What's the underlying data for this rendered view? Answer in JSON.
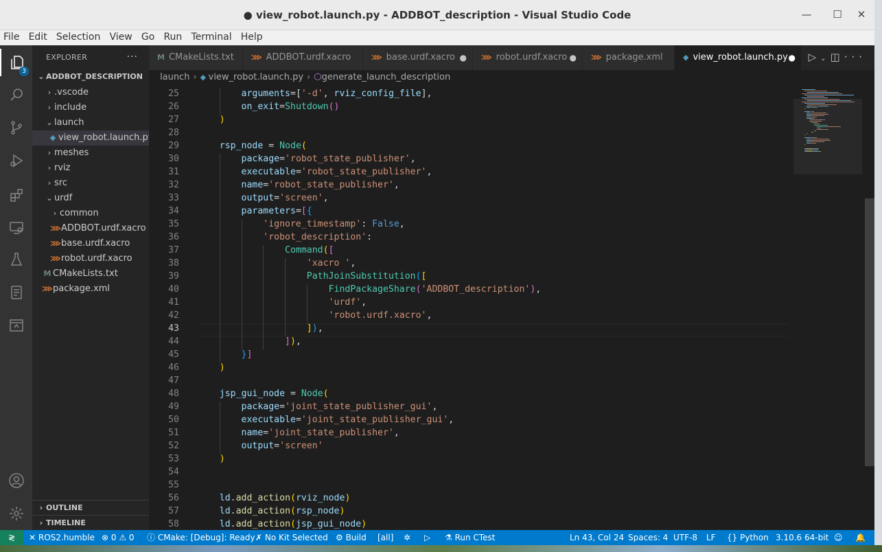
{
  "window": {
    "title": "● view_robot.launch.py - ADDBOT_description - Visual Studio Code",
    "controls": [
      "—",
      "☐",
      "✕"
    ]
  },
  "menu": [
    "File",
    "Edit",
    "Selection",
    "View",
    "Go",
    "Run",
    "Terminal",
    "Help"
  ],
  "activity": {
    "explorer_badge": "3"
  },
  "sidebar": {
    "title": "EXPLORER",
    "more": "···",
    "root": "ADDBOT_DESCRIPTION",
    "items": [
      {
        "label": ".vscode",
        "chev": "›"
      },
      {
        "label": "include",
        "chev": "›"
      },
      {
        "label": "launch",
        "chev": "⌄"
      },
      {
        "label": "view_robot.launch.py",
        "icon": "py"
      },
      {
        "label": "meshes",
        "chev": "›"
      },
      {
        "label": "rviz",
        "chev": "›"
      },
      {
        "label": "src",
        "chev": "›"
      },
      {
        "label": "urdf",
        "chev": "⌄"
      },
      {
        "label": "common",
        "chev": "›"
      },
      {
        "label": "ADDBOT.urdf.xacro",
        "icon": "xml"
      },
      {
        "label": "base.urdf.xacro",
        "icon": "xml"
      },
      {
        "label": "robot.urdf.xacro",
        "icon": "xml"
      },
      {
        "label": "CMakeLists.txt",
        "icon": "cm"
      },
      {
        "label": "package.xml",
        "icon": "xml"
      }
    ],
    "outline": "OUTLINE",
    "timeline": "TIMELINE"
  },
  "tabs": [
    {
      "label": "CMakeLists.txt",
      "icon": "M"
    },
    {
      "label": "ADDBOT.urdf.xacro",
      "icon": "⋙"
    },
    {
      "label": "base.urdf.xacro",
      "icon": "⋙",
      "dot": "●"
    },
    {
      "label": "robot.urdf.xacro",
      "icon": "⋙",
      "dot": "●"
    },
    {
      "label": "package.xml",
      "icon": "⋙"
    },
    {
      "label": "view_robot.launch.py",
      "icon": "◆",
      "dot": "●"
    }
  ],
  "breadcrumb": [
    "launch",
    "view_robot.launch.py",
    "generate_launch_description"
  ],
  "editor": {
    "current_line": 43,
    "lines": [
      {
        "n": "25",
        "tokens": [
          [
            "        ",
            ""
          ],
          [
            "arguments",
            "v"
          ],
          [
            "=[",
            "p"
          ],
          [
            "'-d'",
            "s"
          ],
          [
            ", ",
            "p"
          ],
          [
            "rviz_config_file",
            "v"
          ],
          [
            "],",
            "p"
          ]
        ]
      },
      {
        "n": "26",
        "tokens": [
          [
            "        ",
            ""
          ],
          [
            "on_exit",
            "v"
          ],
          [
            "=",
            "p"
          ],
          [
            "Shutdown",
            "c"
          ],
          [
            "()",
            "b2"
          ]
        ]
      },
      {
        "n": "27",
        "tokens": [
          [
            "    ",
            ""
          ],
          [
            ")",
            "b1"
          ]
        ]
      },
      {
        "n": "28",
        "tokens": []
      },
      {
        "n": "29",
        "tokens": [
          [
            "    ",
            ""
          ],
          [
            "rsp_node",
            "v"
          ],
          [
            " = ",
            "p"
          ],
          [
            "Node",
            "c"
          ],
          [
            "(",
            "b1"
          ]
        ]
      },
      {
        "n": "30",
        "tokens": [
          [
            "        ",
            ""
          ],
          [
            "package",
            "v"
          ],
          [
            "=",
            "p"
          ],
          [
            "'robot_state_publisher'",
            "s"
          ],
          [
            ",",
            "p"
          ]
        ]
      },
      {
        "n": "31",
        "tokens": [
          [
            "        ",
            ""
          ],
          [
            "executable",
            "v"
          ],
          [
            "=",
            "p"
          ],
          [
            "'robot_state_publisher'",
            "s"
          ],
          [
            ",",
            "p"
          ]
        ]
      },
      {
        "n": "32",
        "tokens": [
          [
            "        ",
            ""
          ],
          [
            "name",
            "v"
          ],
          [
            "=",
            "p"
          ],
          [
            "'robot_state_publisher'",
            "s"
          ],
          [
            ",",
            "p"
          ]
        ]
      },
      {
        "n": "33",
        "tokens": [
          [
            "        ",
            ""
          ],
          [
            "output",
            "v"
          ],
          [
            "=",
            "p"
          ],
          [
            "'screen'",
            "s"
          ],
          [
            ",",
            "p"
          ]
        ]
      },
      {
        "n": "34",
        "tokens": [
          [
            "        ",
            ""
          ],
          [
            "parameters",
            "v"
          ],
          [
            "=",
            "p"
          ],
          [
            "[",
            "b2"
          ],
          [
            "{",
            "b3"
          ]
        ]
      },
      {
        "n": "35",
        "tokens": [
          [
            "            ",
            ""
          ],
          [
            "'ignore_timestamp'",
            "s"
          ],
          [
            ": ",
            "p"
          ],
          [
            "False",
            "k"
          ],
          [
            ",",
            "p"
          ]
        ]
      },
      {
        "n": "36",
        "tokens": [
          [
            "            ",
            ""
          ],
          [
            "'robot_description'",
            "s"
          ],
          [
            ":",
            "p"
          ]
        ]
      },
      {
        "n": "37",
        "tokens": [
          [
            "                ",
            ""
          ],
          [
            "Command",
            "c"
          ],
          [
            "(",
            "b1"
          ],
          [
            "[",
            "b2"
          ]
        ]
      },
      {
        "n": "38",
        "tokens": [
          [
            "                    ",
            ""
          ],
          [
            "'xacro '",
            "s"
          ],
          [
            ",",
            "p"
          ]
        ]
      },
      {
        "n": "39",
        "tokens": [
          [
            "                    ",
            ""
          ],
          [
            "PathJoinSubstitution",
            "c"
          ],
          [
            "(",
            "b3"
          ],
          [
            "[",
            "b1"
          ]
        ]
      },
      {
        "n": "40",
        "tokens": [
          [
            "                        ",
            ""
          ],
          [
            "FindPackageShare",
            "c"
          ],
          [
            "(",
            "b2"
          ],
          [
            "'ADDBOT_description'",
            "s"
          ],
          [
            ")",
            "b2"
          ],
          [
            ",",
            "p"
          ]
        ]
      },
      {
        "n": "41",
        "tokens": [
          [
            "                        ",
            ""
          ],
          [
            "'urdf'",
            "s"
          ],
          [
            ",",
            "p"
          ]
        ]
      },
      {
        "n": "42",
        "tokens": [
          [
            "                        ",
            ""
          ],
          [
            "'robot.urdf.xacro'",
            "s"
          ],
          [
            ",",
            "p"
          ]
        ]
      },
      {
        "n": "43",
        "tokens": [
          [
            "                    ",
            ""
          ],
          [
            "]",
            "b1"
          ],
          [
            ")",
            "b3"
          ],
          [
            ",",
            "p"
          ]
        ]
      },
      {
        "n": "44",
        "tokens": [
          [
            "                ",
            ""
          ],
          [
            "]",
            "b2"
          ],
          [
            ")",
            "b1"
          ],
          [
            ",",
            "p"
          ]
        ]
      },
      {
        "n": "45",
        "tokens": [
          [
            "        ",
            ""
          ],
          [
            "}",
            "b3"
          ],
          [
            "]",
            "b2"
          ]
        ]
      },
      {
        "n": "46",
        "tokens": [
          [
            "    ",
            ""
          ],
          [
            ")",
            "b1"
          ]
        ]
      },
      {
        "n": "47",
        "tokens": []
      },
      {
        "n": "48",
        "tokens": [
          [
            "    ",
            ""
          ],
          [
            "jsp_gui_node",
            "v"
          ],
          [
            " = ",
            "p"
          ],
          [
            "Node",
            "c"
          ],
          [
            "(",
            "b1"
          ]
        ]
      },
      {
        "n": "49",
        "tokens": [
          [
            "        ",
            ""
          ],
          [
            "package",
            "v"
          ],
          [
            "=",
            "p"
          ],
          [
            "'joint_state_publisher_gui'",
            "s"
          ],
          [
            ",",
            "p"
          ]
        ]
      },
      {
        "n": "50",
        "tokens": [
          [
            "        ",
            ""
          ],
          [
            "executable",
            "v"
          ],
          [
            "=",
            "p"
          ],
          [
            "'joint_state_publisher_gui'",
            "s"
          ],
          [
            ",",
            "p"
          ]
        ]
      },
      {
        "n": "51",
        "tokens": [
          [
            "        ",
            ""
          ],
          [
            "name",
            "v"
          ],
          [
            "=",
            "p"
          ],
          [
            "'joint_state_publisher'",
            "s"
          ],
          [
            ",",
            "p"
          ]
        ]
      },
      {
        "n": "52",
        "tokens": [
          [
            "        ",
            ""
          ],
          [
            "output",
            "v"
          ],
          [
            "=",
            "p"
          ],
          [
            "'screen'",
            "s"
          ]
        ]
      },
      {
        "n": "53",
        "tokens": [
          [
            "    ",
            ""
          ],
          [
            ")",
            "b1"
          ]
        ]
      },
      {
        "n": "54",
        "tokens": []
      },
      {
        "n": "55",
        "tokens": []
      },
      {
        "n": "56",
        "tokens": [
          [
            "    ",
            ""
          ],
          [
            "ld",
            "v"
          ],
          [
            ".",
            "p"
          ],
          [
            "add_action",
            "f"
          ],
          [
            "(",
            "b1"
          ],
          [
            "rviz_node",
            "v"
          ],
          [
            ")",
            "b1"
          ]
        ]
      },
      {
        "n": "57",
        "tokens": [
          [
            "    ",
            ""
          ],
          [
            "ld",
            "v"
          ],
          [
            ".",
            "p"
          ],
          [
            "add_action",
            "f"
          ],
          [
            "(",
            "b1"
          ],
          [
            "rsp_node",
            "v"
          ],
          [
            ")",
            "b1"
          ]
        ]
      },
      {
        "n": "58",
        "tokens": [
          [
            "    ",
            ""
          ],
          [
            "ld",
            "v"
          ],
          [
            ".",
            "p"
          ],
          [
            "add_action",
            "f"
          ],
          [
            "(",
            "b1"
          ],
          [
            "jsp_gui_node",
            "v"
          ],
          [
            ")",
            "b1"
          ]
        ]
      }
    ]
  },
  "statusbar": {
    "remote": "≷",
    "ros": "ROS2.humble",
    "problems": "⊗ 0 ⚠ 0",
    "cmake": "ⓘ CMake: [Debug]: Ready",
    "kit": "✗ No Kit Selected",
    "build": "⚙ Build",
    "target": "[all]",
    "debug": "✲",
    "run": "▷",
    "ctest": "⚗ Run CTest",
    "position": "Ln 43, Col 24",
    "spaces": "Spaces: 4",
    "encoding": "UTF-8",
    "eol": "LF",
    "language": "{} Python",
    "interpreter": "3.10.6 64-bit",
    "feedback": "☺",
    "bell": "🔔"
  }
}
